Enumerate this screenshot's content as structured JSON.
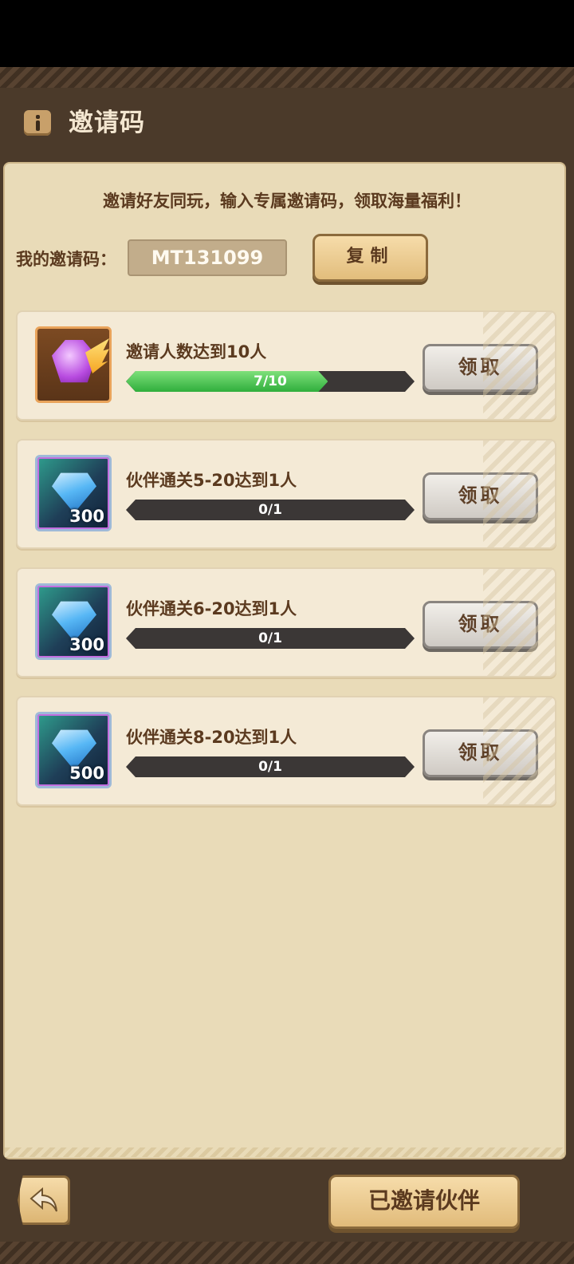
{
  "header": {
    "title": "邀请码"
  },
  "invite": {
    "description": "邀请好友同玩，输入专属邀请码，领取海量福利！",
    "code_label": "我的邀请码：",
    "code_value": "MT131099",
    "copy_label": "复制"
  },
  "tasks": [
    {
      "title": "邀请人数达到10人",
      "progress_text": "7/10",
      "progress": 0.7,
      "reward_icon": "purple-gem-wing-icon",
      "reward_amount": "",
      "claim_label": "领取"
    },
    {
      "title": "伙伴通关5-20达到1人",
      "progress_text": "0/1",
      "progress": 0,
      "reward_icon": "diamond-icon",
      "reward_amount": "300",
      "claim_label": "领取"
    },
    {
      "title": "伙伴通关6-20达到1人",
      "progress_text": "0/1",
      "progress": 0,
      "reward_icon": "diamond-icon",
      "reward_amount": "300",
      "claim_label": "领取"
    },
    {
      "title": "伙伴通关8-20达到1人",
      "progress_text": "0/1",
      "progress": 0,
      "reward_icon": "diamond-icon",
      "reward_amount": "500",
      "claim_label": "领取"
    }
  ],
  "footer": {
    "invited_label": "已邀请伙伴",
    "back_icon": "back-arrow-icon"
  },
  "colors": {
    "frame": "#4b3a2a",
    "panel": "#e9dbb8",
    "text_brown": "#5b3a1f",
    "progress_green": "#2fae3c"
  }
}
